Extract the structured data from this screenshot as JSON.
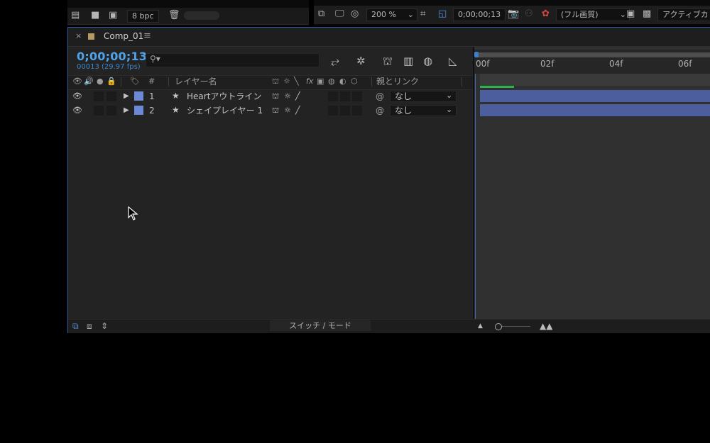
{
  "toolbar_left": {
    "bpc_label": "8 bpc"
  },
  "toolbar_right": {
    "zoom": "200 %",
    "timecode": "0;00;00;13",
    "resolution": "(フル画質)",
    "active_camera": "アクティブカ"
  },
  "panel_tab": {
    "close": "×",
    "title": "Comp_01",
    "menu": "≡"
  },
  "timeline": {
    "timecode": "0;00;00;13",
    "frame_fps": "00013 (29.97 fps)",
    "search_placeholder": ""
  },
  "columns": {
    "number": "#",
    "layer_name": "レイヤー名",
    "fx": "fx",
    "parent_link": "親とリンク"
  },
  "layers": [
    {
      "number": "1",
      "name": "Heartアウトライン",
      "parent": "なし"
    },
    {
      "number": "2",
      "name": "シェイプレイヤー 1",
      "parent": "なし"
    }
  ],
  "ruler": {
    "ticks": [
      "00f",
      "02f",
      "04f",
      "06f"
    ]
  },
  "bottom": {
    "switch_mode": "スイッチ / モード"
  },
  "colors": {
    "accent_blue": "#4fa3ea",
    "label_color": "#6b89d6",
    "layer_bar": "#4d5e9f",
    "cache_green": "#2db14a",
    "comp_icon": "#b79a63"
  }
}
